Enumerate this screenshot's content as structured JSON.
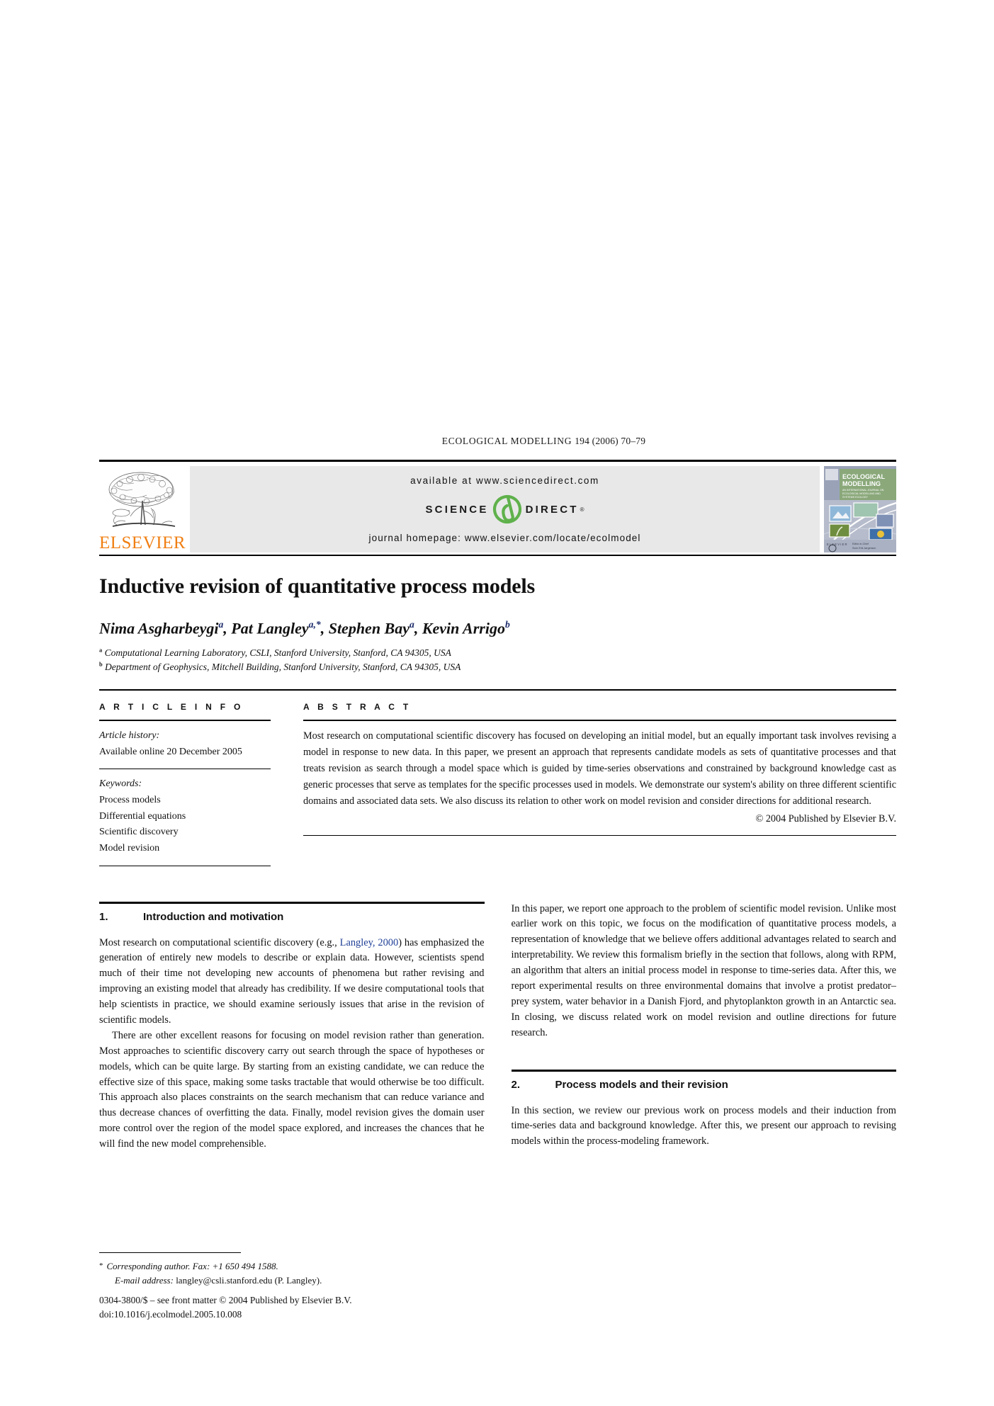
{
  "running_head": {
    "journal": "ECOLOGICAL MODELLING",
    "volume_issue": "194 (2006) 70–79"
  },
  "masthead": {
    "publisher_name": "ELSEVIER",
    "publisher_color": "#F07F13",
    "available_at": "available at www.sciencedirect.com",
    "sciencedirect_left": "SCIENCE",
    "sciencedirect_right": "DIRECT",
    "sciencedirect_tm": "®",
    "sciencedirect_green": "#5FB14B",
    "journal_homepage": "journal homepage: www.elsevier.com/locate/ecolmodel",
    "cover": {
      "title_line1": "ECOLOGICAL",
      "title_line2": "MODELLING",
      "subtitle": "AN INTERNATIONAL JOURNAL ON ECOLOGICAL MODELLING AND SYSTEMS ECOLOGY",
      "background_color": "#8d95ad",
      "band_color": "#7f9a6e"
    }
  },
  "article": {
    "title": "Inductive revision of quantitative process models",
    "authors": [
      {
        "name": "Nima Asgharbeygi",
        "sup": "a"
      },
      {
        "name": "Pat Langley",
        "sup": "a,*"
      },
      {
        "name": "Stephen Bay",
        "sup": "a"
      },
      {
        "name": "Kevin Arrigo",
        "sup": "b"
      }
    ],
    "affiliations": [
      {
        "mark": "a",
        "text": "Computational Learning Laboratory, CSLI, Stanford University, Stanford, CA 94305, USA"
      },
      {
        "mark": "b",
        "text": "Department of Geophysics, Mitchell Building, Stanford University, Stanford, CA 94305, USA"
      }
    ]
  },
  "article_info": {
    "heading": "A R T I C L E    I N F O",
    "history_label": "Article history:",
    "history_value": "Available online 20 December 2005",
    "keywords_label": "Keywords:",
    "keywords": [
      "Process models",
      "Differential equations",
      "Scientific discovery",
      "Model revision"
    ]
  },
  "abstract": {
    "heading": "A B S T R A C T",
    "text": "Most research on computational scientific discovery has focused on developing an initial model, but an equally important task involves revising a model in response to new data. In this paper, we present an approach that represents candidate models as sets of quantitative processes and that treats revision as search through a model space which is guided by time-series observations and constrained by background knowledge cast as generic processes that serve as templates for the specific processes used in models. We demonstrate our system's ability on three different scientific domains and associated data sets. We also discuss its relation to other work on model revision and consider directions for additional research.",
    "copyright": "© 2004 Published by Elsevier B.V."
  },
  "sections": [
    {
      "number": "1.",
      "title": "Introduction and motivation",
      "paragraphs": [
        {
          "before": "Most research on computational scientific discovery (e.g., ",
          "link": "Langley, 2000",
          "after": ") has emphasized the generation of entirely new models to describe or explain data. However, scientists spend much of their time not developing new accounts of phenomena but rather revising and improving an existing model that already has credibility. If we desire computational tools that help scientists in practice, we should examine seriously issues that arise in the revision of scientific models."
        },
        {
          "text": "There are other excellent reasons for focusing on model revision rather than generation. Most approaches to scientific discovery carry out search through the space of hypotheses or models, which can be quite large. By starting from an existing candidate, we can reduce the effective size of this space, making some tasks tractable that would otherwise be too difficult. This approach also places constraints on the search mechanism that can reduce variance and thus decrease chances of overfitting the data. Finally, model revision gives the domain user more control over the region of the model space explored, and increases the chances that he will find the new model comprehensible."
        }
      ]
    },
    {
      "number": "2.",
      "title": "Process models and their revision",
      "paragraphs": [
        {
          "text": "In this section, we review our previous work on process models and their induction from time-series data and background knowledge. After this, we present our approach to revising models within the process-modeling framework."
        }
      ]
    }
  ],
  "right_column_intro": {
    "text": "In this paper, we report one approach to the problem of scientific model revision. Unlike most earlier work on this topic, we focus on the modification of quantitative process models, a representation of knowledge that we believe offers additional advantages related to search and interpretability. We review this formalism briefly in the section that follows, along with RPM, an algorithm that alters an initial process model in response to time-series data. After this, we report experimental results on three environmental domains that involve a protist predator–prey system, water behavior in a Danish Fjord, and phytoplankton growth in an Antarctic sea. In closing, we discuss related work on model revision and outline directions for future research."
  },
  "footnotes": {
    "corresponding": "Corresponding author. Fax: +1 650 494 1588.",
    "email_label": "E-mail address:",
    "email_value": "langley@csli.stanford.edu (P. Langley).",
    "front_matter": "0304-3800/$ – see front matter © 2004 Published by Elsevier B.V.",
    "doi": "doi:10.1016/j.ecolmodel.2005.10.008"
  }
}
